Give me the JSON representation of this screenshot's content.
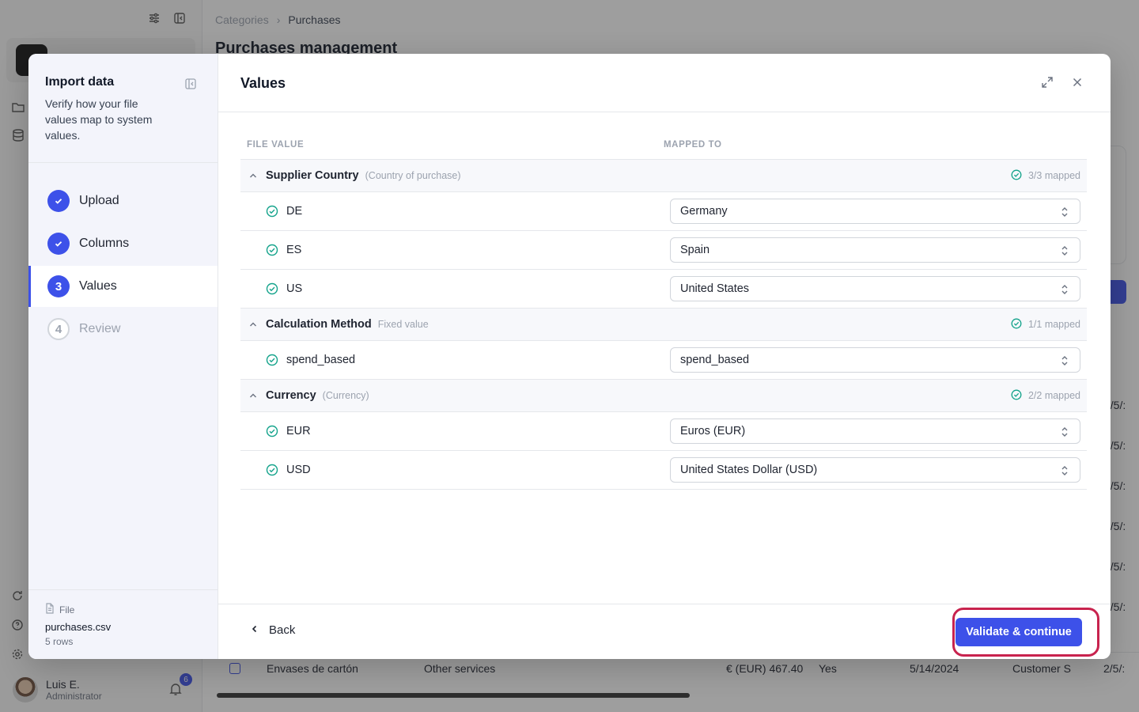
{
  "app": {
    "breadcrumb": [
      "Categories",
      "Purchases"
    ],
    "page_title": "Purchases management",
    "user": {
      "name": "Luis E.",
      "role": "Administrator",
      "notifications": "6"
    },
    "bg_row": {
      "name": "Envases de cartón",
      "category": "Other services",
      "amount": "€ (EUR) 467.40",
      "flag": "Yes",
      "date": "5/14/2024",
      "owner": "Customer S",
      "created": "2/5/:"
    },
    "bg_dates": [
      "2/5/:",
      "2/5/:",
      "2/5/:",
      "2/5/:",
      "2/5/:",
      "2/5/:"
    ]
  },
  "wizard": {
    "title": "Import data",
    "description": "Verify how your file values map to system values.",
    "steps": [
      {
        "num": "1",
        "label": "Upload",
        "state": "done"
      },
      {
        "num": "2",
        "label": "Columns",
        "state": "done"
      },
      {
        "num": "3",
        "label": "Values",
        "state": "current"
      },
      {
        "num": "4",
        "label": "Review",
        "state": "todo"
      }
    ],
    "file": {
      "label": "File",
      "name": "purchases.csv",
      "rows": "5 rows"
    }
  },
  "values": {
    "title": "Values",
    "columns": {
      "file_value": "FILE VALUE",
      "mapped_to": "MAPPED TO"
    },
    "groups": [
      {
        "name": "Supplier Country",
        "hint": "(Country of purchase)",
        "status": "3/3 mapped",
        "rows": [
          {
            "file": "DE",
            "mapped": "Germany"
          },
          {
            "file": "ES",
            "mapped": "Spain"
          },
          {
            "file": "US",
            "mapped": "United States"
          }
        ]
      },
      {
        "name": "Calculation Method",
        "hint": "Fixed value",
        "status": "1/1 mapped",
        "rows": [
          {
            "file": "spend_based",
            "mapped": "spend_based"
          }
        ]
      },
      {
        "name": "Currency",
        "hint": "(Currency)",
        "status": "2/2 mapped",
        "rows": [
          {
            "file": "EUR",
            "mapped": "Euros (EUR)"
          },
          {
            "file": "USD",
            "mapped": "United States Dollar (USD)"
          }
        ]
      }
    ],
    "back_label": "Back",
    "validate_label": "Validate & continue"
  },
  "colors": {
    "accent": "#3d51e9",
    "success": "#14a38b",
    "highlight": "#c8234e"
  }
}
